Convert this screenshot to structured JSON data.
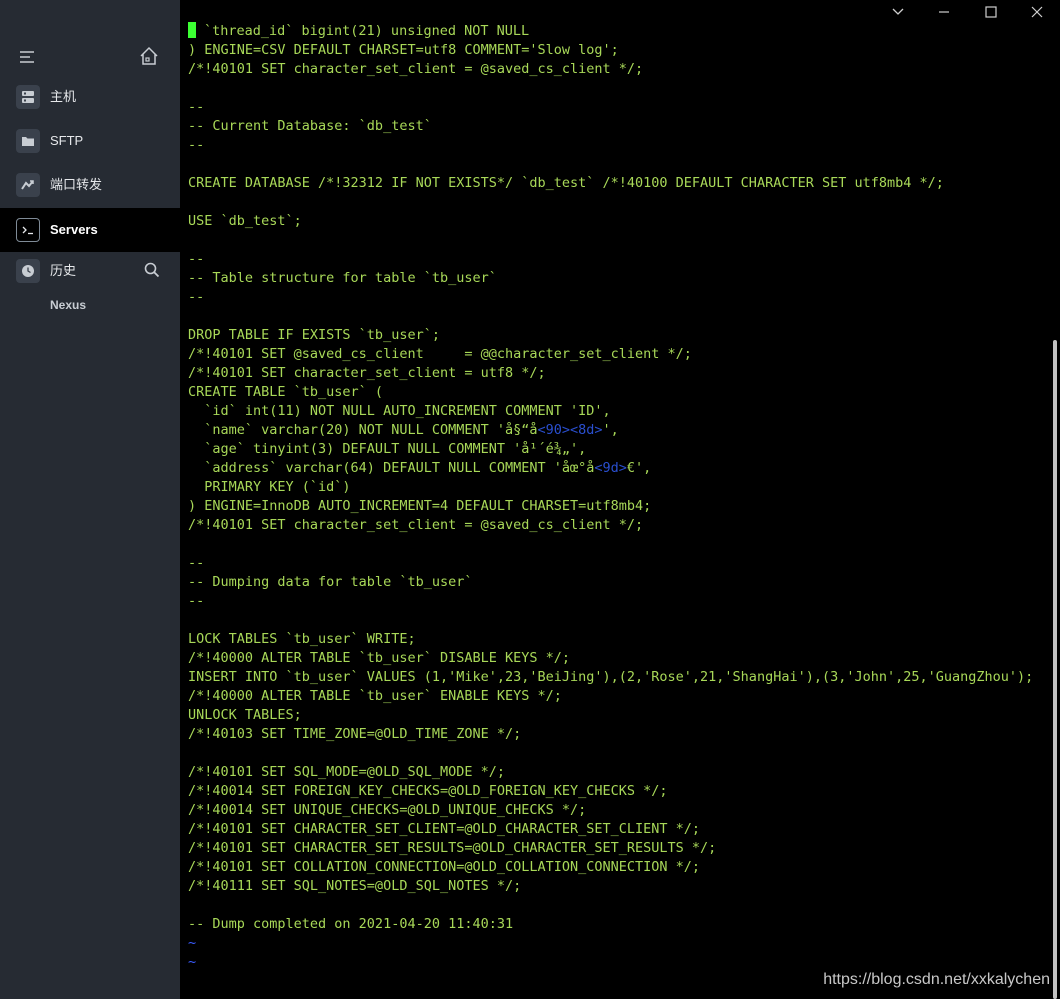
{
  "sidebar": {
    "items": [
      {
        "label": "主机",
        "icon": "server-grid-icon"
      },
      {
        "label": "SFTP",
        "icon": "folder-icon"
      },
      {
        "label": "端口转发",
        "icon": "port-forward-icon"
      },
      {
        "label": "Servers",
        "icon": "terminal-icon"
      },
      {
        "label": "历史",
        "icon": "history-clock-icon"
      }
    ],
    "active": "Servers",
    "history_sub_item": "Nexus"
  },
  "terminal": {
    "lines": [
      "`thread_id` bigint(21) unsigned NOT NULL",
      ") ENGINE=CSV DEFAULT CHARSET=utf8 COMMENT='Slow log';",
      "/*!40101 SET character_set_client = @saved_cs_client */;",
      "",
      "--",
      "-- Current Database: `db_test`",
      "--",
      "",
      "CREATE DATABASE /*!32312 IF NOT EXISTS*/ `db_test` /*!40100 DEFAULT CHARACTER SET utf8mb4 */;",
      "",
      "USE `db_test`;",
      "",
      "--",
      "-- Table structure for table `tb_user`",
      "--",
      "",
      "DROP TABLE IF EXISTS `tb_user`;",
      "/*!40101 SET @saved_cs_client     = @@character_set_client */;",
      "/*!40101 SET character_set_client = utf8 */;",
      "CREATE TABLE `tb_user` (",
      "  `id` int(11) NOT NULL AUTO_INCREMENT COMMENT 'ID',",
      "  `name` varchar(20) NOT NULL COMMENT 'å§“å<90><8d>',",
      "  `age` tinyint(3) DEFAULT NULL COMMENT 'å¹´é¾„',",
      "  `address` varchar(64) DEFAULT NULL COMMENT 'åœ°å<9d>€',",
      "  PRIMARY KEY (`id`)",
      ") ENGINE=InnoDB AUTO_INCREMENT=4 DEFAULT CHARSET=utf8mb4;",
      "/*!40101 SET character_set_client = @saved_cs_client */;",
      "",
      "--",
      "-- Dumping data for table `tb_user`",
      "--",
      "",
      "LOCK TABLES `tb_user` WRITE;",
      "/*!40000 ALTER TABLE `tb_user` DISABLE KEYS */;",
      "INSERT INTO `tb_user` VALUES (1,'Mike',23,'BeiJing'),(2,'Rose',21,'ShangHai'),(3,'John',25,'GuangZhou');",
      "/*!40000 ALTER TABLE `tb_user` ENABLE KEYS */;",
      "UNLOCK TABLES;",
      "/*!40103 SET TIME_ZONE=@OLD_TIME_ZONE */;",
      "",
      "/*!40101 SET SQL_MODE=@OLD_SQL_MODE */;",
      "/*!40014 SET FOREIGN_KEY_CHECKS=@OLD_FOREIGN_KEY_CHECKS */;",
      "/*!40014 SET UNIQUE_CHECKS=@OLD_UNIQUE_CHECKS */;",
      "/*!40101 SET CHARACTER_SET_CLIENT=@OLD_CHARACTER_SET_CLIENT */;",
      "/*!40101 SET CHARACTER_SET_RESULTS=@OLD_CHARACTER_SET_RESULTS */;",
      "/*!40101 SET COLLATION_CONNECTION=@OLD_COLLATION_CONNECTION */;",
      "/*!40111 SET SQL_NOTES=@OLD_SQL_NOTES */;",
      "",
      "-- Dump completed on 2021-04-20 11:40:31",
      "~",
      "~"
    ],
    "garbled_fragments": [
      "<90><8d>",
      "<9d>"
    ],
    "text_color": "#a8d858",
    "cursor_color": "#3cff33",
    "garbled_color": "#2a4fd0",
    "tilde_color": "#3a5cff"
  },
  "window_controls": [
    "chevron-down-icon",
    "minimize-icon",
    "maximize-icon",
    "close-icon"
  ],
  "scrollbar": {
    "position": 0.34
  },
  "watermark": "https://blog.csdn.net/xxkalychen"
}
